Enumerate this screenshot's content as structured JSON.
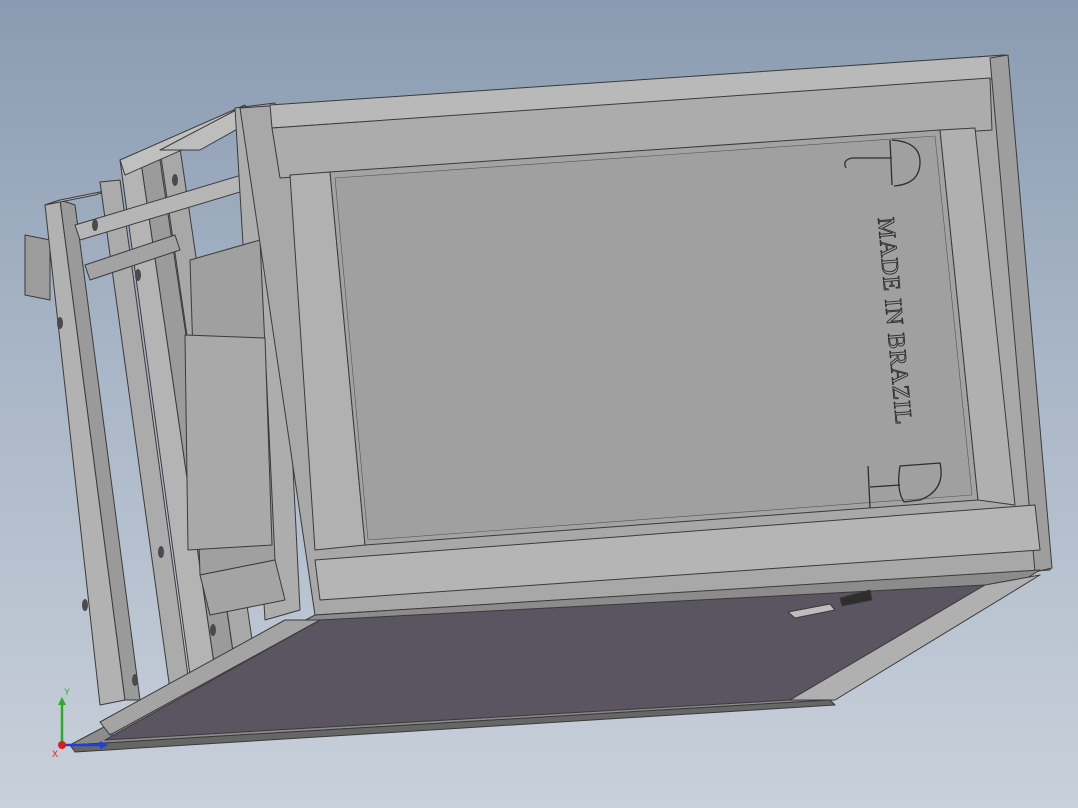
{
  "model": {
    "engraving_text": "MADE IN BRAZIL"
  },
  "triad": {
    "x_label": "X",
    "y_label": "Y",
    "z_label": "Z",
    "colors": {
      "x": "#d81e1e",
      "y": "#2faa2f",
      "z": "#1e3fd8"
    }
  },
  "colors": {
    "background_top": "#8a9bb1",
    "background_bottom": "#c8d0da",
    "body_face": "#a6a6a6",
    "body_edge": "#3a3a3a",
    "dark_panel": "#5a5560"
  }
}
